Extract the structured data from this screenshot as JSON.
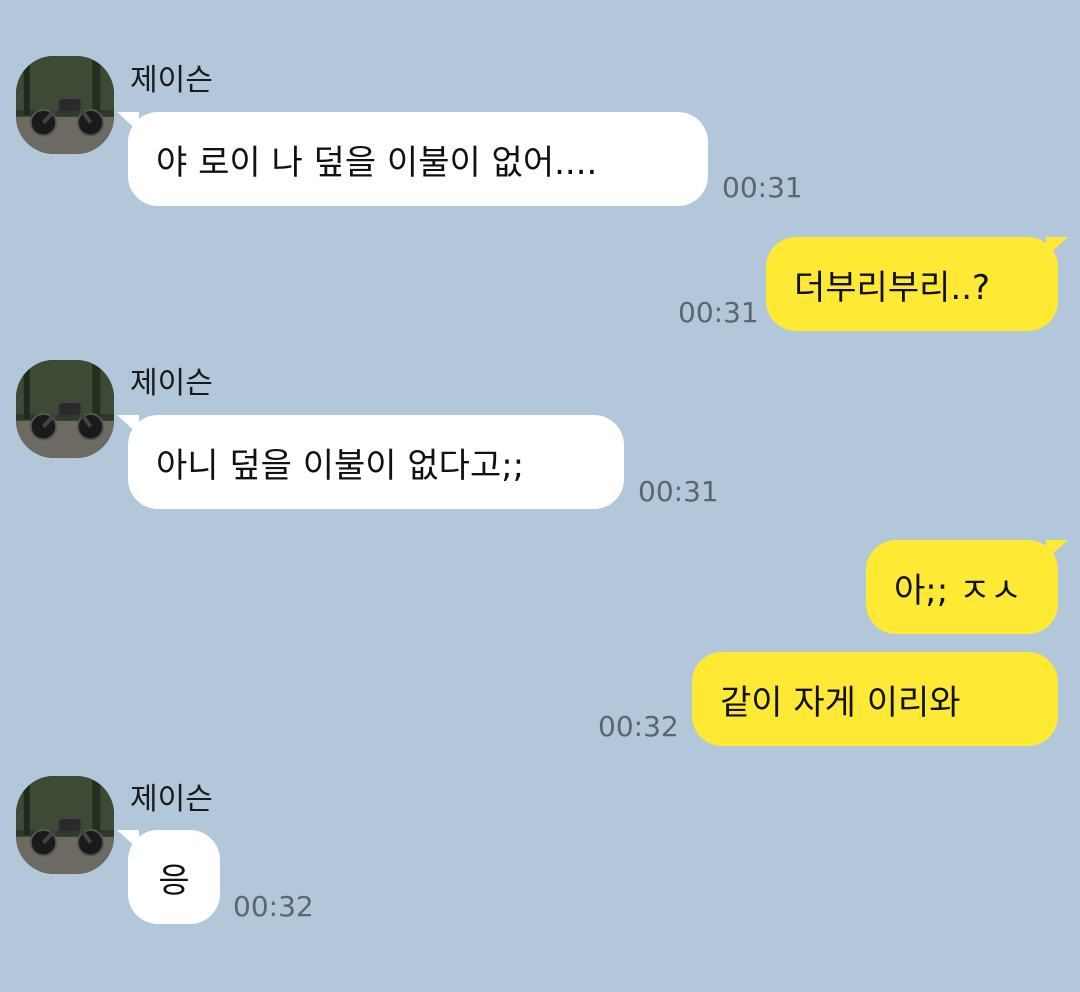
{
  "colors": {
    "background": "#b2c7da",
    "incoming_bubble": "#ffffff",
    "outgoing_bubble": "#fee934",
    "timestamp": "#5b6670"
  },
  "messages": [
    {
      "direction": "in",
      "sender": "제이슨",
      "avatar_icon": "motorcycle-avatar-icon",
      "text": "야 로이 나 덮을 이불이 없어....",
      "time": "00:31"
    },
    {
      "direction": "out",
      "text": "더부리부리..?",
      "time": "00:31"
    },
    {
      "direction": "in",
      "sender": "제이슨",
      "avatar_icon": "motorcycle-avatar-icon",
      "text": "아니 덮을 이불이 없다고;;",
      "time": "00:31"
    },
    {
      "direction": "out",
      "text": "아;; ㅈㅅ",
      "time": ""
    },
    {
      "direction": "out",
      "text": "같이 자게 이리와",
      "time": "00:32"
    },
    {
      "direction": "in",
      "sender": "제이슨",
      "avatar_icon": "motorcycle-avatar-icon",
      "text": "응",
      "time": "00:32"
    }
  ]
}
